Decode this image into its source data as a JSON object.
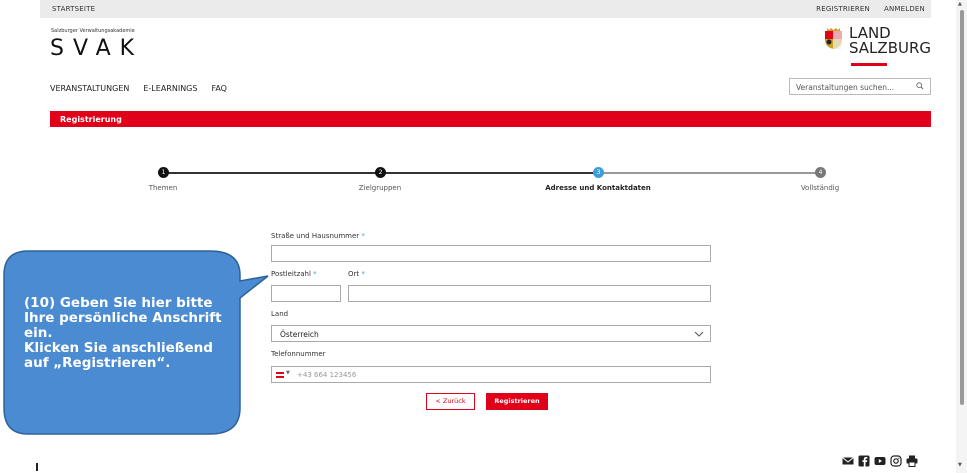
{
  "topbar": {
    "home": "STARTSEITE",
    "register": "REGISTRIEREN",
    "login": "ANMELDEN"
  },
  "brand": {
    "subtitle": "Salzburger Verwaltungsakademie",
    "logo": "SVAK"
  },
  "partner": {
    "line1": "LAND",
    "line2": "SALZBURG",
    "icon": "coat-of-arms-icon",
    "accent": "#e0001a"
  },
  "nav": {
    "items": [
      "VERANSTALTUNGEN",
      "E-LEARNINGS",
      "FAQ"
    ]
  },
  "search": {
    "placeholder": "Veranstaltungen suchen...",
    "icon": "search-icon"
  },
  "section": {
    "title": "Registrierung"
  },
  "steps": [
    {
      "num": "1",
      "label": "Themen",
      "state": "done"
    },
    {
      "num": "2",
      "label": "Zielgruppen",
      "state": "done"
    },
    {
      "num": "3",
      "label": "Adresse und Kontaktdaten",
      "state": "active"
    },
    {
      "num": "4",
      "label": "Vollständig",
      "state": "pending"
    }
  ],
  "form": {
    "street": {
      "label": "Straße und Hausnummer",
      "required": "*",
      "value": ""
    },
    "zip": {
      "label": "Postleitzahl",
      "required": "*",
      "value": ""
    },
    "city": {
      "label": "Ort",
      "required": "*",
      "value": ""
    },
    "country": {
      "label": "Land",
      "value": "Österreich"
    },
    "phone": {
      "label": "Telefonnummer",
      "placeholder": "+43 664 123456",
      "flag": "austria-flag-icon"
    }
  },
  "buttons": {
    "back": "< Zurück",
    "register": "Registrieren"
  },
  "callout": {
    "lines": [
      "(10) Geben Sie hier bitte",
      "Ihre persönliche Anschrift",
      "ein.",
      "Klicken Sie anschließend",
      "auf „Registrieren“."
    ],
    "color": "#4a8bd1"
  },
  "social": {
    "icons": [
      "mail-icon",
      "facebook-icon",
      "youtube-icon",
      "instagram-icon",
      "print-icon"
    ]
  },
  "colors": {
    "red": "#e0001a",
    "blue": "#3d9ddd"
  }
}
